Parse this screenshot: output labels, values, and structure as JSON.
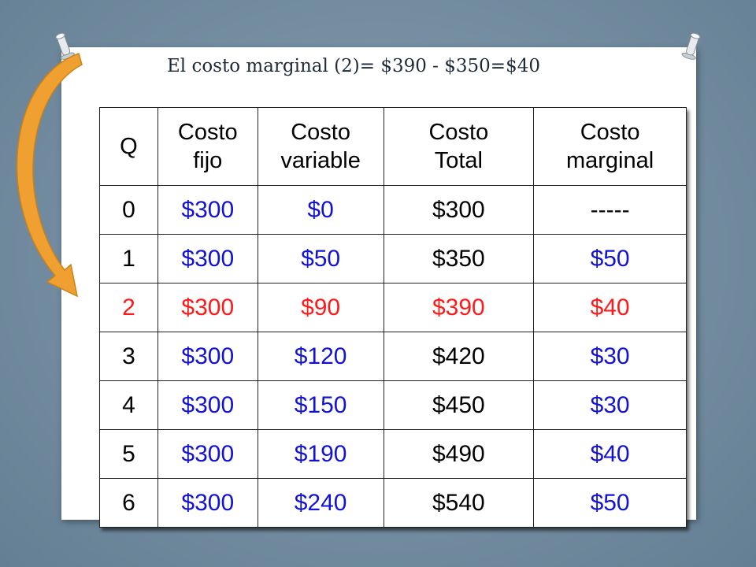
{
  "title": "El costo marginal (2)= $390 - $350=$40",
  "table": {
    "headers": [
      "Q",
      "Costo fijo",
      "Costo variable",
      "Costo Total",
      "Costo marginal"
    ],
    "rows": [
      [
        "0",
        "$300",
        "$0",
        "$300",
        "-----"
      ],
      [
        "1",
        "$300",
        "$50",
        "$350",
        "$50"
      ],
      [
        "2",
        "$300",
        "$90",
        "$390",
        "$40"
      ],
      [
        "3",
        "$300",
        "$120",
        "$420",
        "$30"
      ],
      [
        "4",
        "$300",
        "$150",
        "$450",
        "$30"
      ],
      [
        "5",
        "$300",
        "$190",
        "$490",
        "$40"
      ],
      [
        "6",
        "$300",
        "$240",
        "$540",
        "$50"
      ]
    ],
    "highlight_row": 2
  },
  "colors": {
    "blue_value": "#1212d6",
    "red_highlight": "#ff1a1a",
    "arrow": "#f0a030",
    "background": "#7790a4"
  },
  "icons": [
    "pushpin-icon",
    "curved-arrow-icon"
  ]
}
